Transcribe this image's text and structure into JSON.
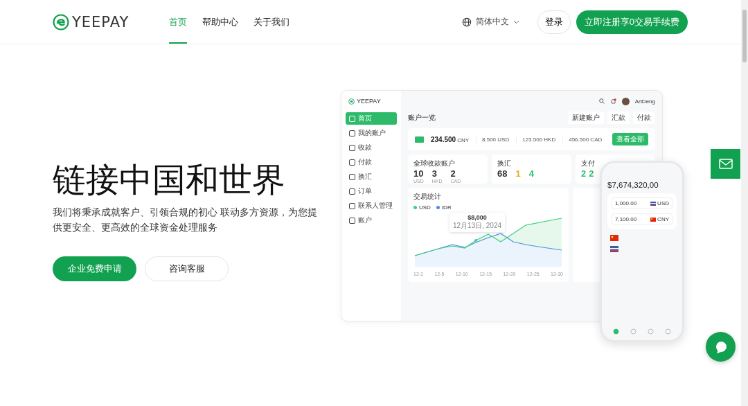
{
  "header": {
    "logo": "YEEPAY",
    "nav": [
      {
        "label": "首页",
        "selected": true
      },
      {
        "label": "帮助中心",
        "selected": false
      },
      {
        "label": "关于我们",
        "selected": false
      }
    ],
    "language": "简体中文",
    "login": "登录",
    "register": "立即注册享0交易手续费"
  },
  "hero": {
    "title": "链接中国和世界",
    "description": "我们将秉承成就客户、引领合规的初心 联动多方资源，为您提供更安全、更高效的全球资金处理服务",
    "buttons": [
      {
        "label": "企业免费申请",
        "kind": "primary"
      },
      {
        "label": "咨询客服",
        "kind": "secondary"
      }
    ]
  },
  "dashboard": {
    "logo": "YEEPAY",
    "sidebar": [
      {
        "label": "首页",
        "selected": true
      },
      {
        "label": "我的账户",
        "selected": false
      },
      {
        "label": "收款",
        "selected": false
      },
      {
        "label": "付款",
        "selected": false
      },
      {
        "label": "换汇",
        "selected": false
      },
      {
        "label": "订单",
        "selected": false
      },
      {
        "label": "联系人管理",
        "selected": false
      },
      {
        "label": "账户",
        "selected": false
      }
    ],
    "user": "ArtDeng",
    "title": "账户一览",
    "actions": [
      "新建账户",
      "汇款",
      "付款"
    ],
    "balance": {
      "amount": "234.500",
      "currency": "CNY",
      "others": [
        "8.500 USD",
        "123.500 HKD",
        "456.500 CAD"
      ],
      "button": "查看全部"
    },
    "cards": [
      {
        "title": "全球收款账户",
        "stats": [
          {
            "value": "10",
            "label": "USD",
            "color": "#333333"
          },
          {
            "value": "3",
            "label": "HKD",
            "color": "#333333"
          },
          {
            "value": "2",
            "label": "CAD",
            "color": "#333333"
          }
        ]
      },
      {
        "title": "换汇",
        "stats": [
          {
            "value": "68",
            "color": "#333333"
          },
          {
            "value": "1",
            "color": "#e0b020"
          },
          {
            "value": "4",
            "color": "#2fbf71"
          }
        ]
      },
      {
        "title": "支付",
        "stats": [
          {
            "value": "2",
            "color": "#2fbf71"
          },
          {
            "value": "2",
            "color": "#2fbf71"
          }
        ]
      }
    ],
    "chart": {
      "title": "交易统计",
      "legend": [
        {
          "name": "USD",
          "color": "#3fcf82"
        },
        {
          "name": "IDR",
          "color": "#4a8fe0"
        }
      ],
      "tooltip": {
        "value": "$8,000",
        "date": "12月13日, 2024"
      },
      "x_labels": [
        "12-1",
        "12-5",
        "12-10",
        "12-15",
        "12-20",
        "12-25",
        "12-30"
      ]
    }
  },
  "phone": {
    "balance": "$7,674,320,00",
    "exchange": [
      {
        "amount": "1,000.00",
        "currency": "USD"
      },
      {
        "amount": "7,100.00",
        "currency": "CNY"
      }
    ]
  }
}
